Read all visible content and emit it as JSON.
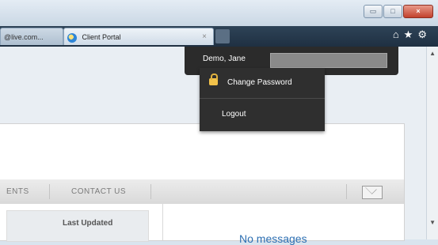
{
  "browser": {
    "left_tab_label": "@live.com...",
    "active_tab_label": "Client Portal",
    "tab_close_glyph": "×",
    "window_buttons": {
      "minimize": "▭",
      "maximize": "□",
      "close": "×"
    },
    "nav_icons": [
      "home-icon",
      "star-icon",
      "gear-icon"
    ],
    "nav_glyphs": "⌂★⚙"
  },
  "user_menu": {
    "display_name": "Demo, Jane",
    "items": [
      {
        "label": "Change Password",
        "icon": "lock-icon"
      },
      {
        "label": "Logout"
      }
    ]
  },
  "nav": {
    "items": [
      "ENTS",
      "CONTACT US"
    ],
    "mail_icon": "mail-icon"
  },
  "content": {
    "last_updated_label": "Last Updated",
    "messages_text": "No messages"
  },
  "colors": {
    "dropdown_bg": "#2f2f2f",
    "accent_blue": "#2d6fb2",
    "lock_yellow": "#f2c24a"
  }
}
